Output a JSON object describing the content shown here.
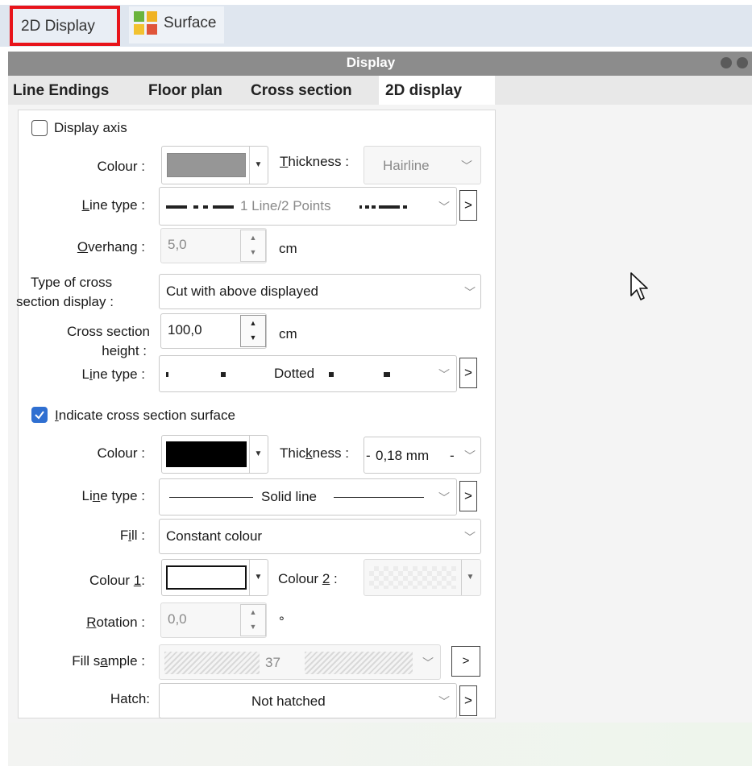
{
  "toolbar": {
    "tab_2d_display": "2D Display",
    "tab_surface": "Surface",
    "accent_color": "#e8141b"
  },
  "panel": {
    "title": "Display",
    "tabs": [
      "Line Endings",
      "Floor plan",
      "Cross section",
      "2D display"
    ],
    "selected_tab": "2D display"
  },
  "axis": {
    "display_axis_label": "Display axis",
    "display_axis_checked": false,
    "colour_label": "Colour :",
    "colour_value": "#969696",
    "thickness_label_pre": "",
    "thickness_label_u": "T",
    "thickness_label_post": "hickness :",
    "thickness_value": "Hairline",
    "line_type_label_u": "L",
    "line_type_label_post": "ine type :",
    "line_type_value": "1 Line/2 Points",
    "overhang_label_u": "O",
    "overhang_label_post": "verhang :",
    "overhang_value": "5,0",
    "overhang_unit": "cm",
    "cross_display_label_1": "Type of cross",
    "cross_display_label_2": "section display :",
    "cross_display_value": "Cut with above displayed",
    "cross_height_label_1": "Cross section",
    "cross_height_label_2": "height :",
    "cross_height_value": "100,0",
    "cross_height_unit": "cm",
    "line_type2_label_pre": "L",
    "line_type2_label_u": "i",
    "line_type2_label_post": "ne type :",
    "line_type2_value": "Dotted"
  },
  "surface": {
    "indicate_label_u": "I",
    "indicate_label_post": "ndicate cross section surface",
    "indicate_checked": true,
    "colour_label": "Colour :",
    "colour_value": "#000000",
    "thickness_label_pre": "Thic",
    "thickness_label_u": "k",
    "thickness_label_post": "ness :",
    "thickness_value": "0,18 mm",
    "line_type_label_pre": "Li",
    "line_type_label_u": "n",
    "line_type_label_post": "e type :",
    "line_type_value": "Solid line",
    "fill_label_pre": "F",
    "fill_label_u": "i",
    "fill_label_post": "ll :",
    "fill_value": "Constant colour",
    "colour1_label_pre": "Colour ",
    "colour1_label_u": "1",
    "colour1_label_post": ":",
    "colour1_value": "#ffffff",
    "colour2_label_pre": "Colour ",
    "colour2_label_u": "2",
    "colour2_label_post": " :",
    "rotation_label_u": "R",
    "rotation_label_post": "otation :",
    "rotation_value": "0,0",
    "rotation_unit": "°",
    "fill_sample_label_pre": "Fill s",
    "fill_sample_label_u": "a",
    "fill_sample_label_post": "mple :",
    "fill_sample_value": "37",
    "hatch_label": "Hatch:",
    "hatch_value": "Not hatched"
  }
}
